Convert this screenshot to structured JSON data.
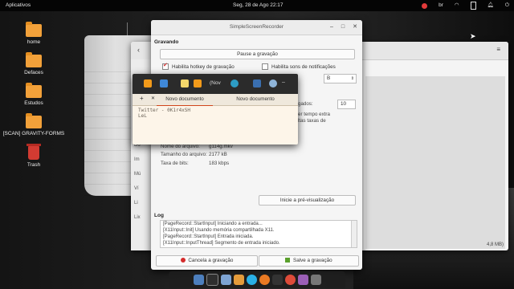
{
  "topbar": {
    "apps_label": "Aplicativos",
    "clock": "Seg, 28 de Ago   22:17",
    "keyboard_layout": "br"
  },
  "desktop": {
    "icons": [
      {
        "label": "home",
        "kind": "folder"
      },
      {
        "label": "Defaces",
        "kind": "folder"
      },
      {
        "label": "Estudos",
        "kind": "folder"
      },
      {
        "label": "[SCAN] GRAVITY-FORMS",
        "kind": "folder"
      },
      {
        "label": "Trash",
        "kind": "trash"
      }
    ]
  },
  "background_window": {
    "sidebar_items": [
      "Do",
      "Im",
      "Mú",
      "Ví",
      "Li",
      "Lix"
    ],
    "size_cell": "4,8 MB)"
  },
  "recorder": {
    "title": "SimpleScreenRecorder",
    "section_recording": "Gravando",
    "pause_button": "Pause a gravação",
    "hotkey_checkbox": "Habilita hotkey de gravação",
    "hotkey_checked": true,
    "sound_checkbox": "Habilita sons de notificações",
    "sound_checked": false,
    "key_select": "B",
    "frames_label": "gados:",
    "frames_value": "10",
    "text_fragment_1": "er tempo extra",
    "text_fragment_2": "ltas taxas de",
    "fields": [
      {
        "label": "Nome do arquivo:",
        "value": "g114g.mkv"
      },
      {
        "label": "Tamanho do arquivo:",
        "value": "2177 kB"
      },
      {
        "label": "Taxa de bits:",
        "value": "183 kbps"
      }
    ],
    "preview_button": "Inicie a pré-visualização",
    "section_log": "Log",
    "log_lines": [
      "[PageRecord::StartInput] Iniciando a entrada...",
      "[X11Input::Init] Usando memória compartilhada X11.",
      "[PageRecord::StartInput] Entrada iniciada.",
      "[X11Input::InputThread] Segmento de entrada iniciado."
    ],
    "cancel_button": "Cancela a gravação",
    "save_button": "Salve a gravação",
    "colors": {
      "cancel_dot": "#d42c2c",
      "save_dot": "#5aa02c"
    }
  },
  "editor": {
    "toolbar_title": "(Nov",
    "tabs": [
      "Novo documento",
      "Novo documento"
    ],
    "lines": [
      "Twitter - 0K1r4xSH",
      "LeL"
    ],
    "colors": {
      "accent": "#d0451b",
      "bg": "#fdf5e9"
    }
  },
  "dock": {
    "apps": [
      "files-icon",
      "terminal-icon",
      "mail-icon",
      "photos-icon",
      "skype-icon",
      "firefox-icon",
      "terminal-icon",
      "chrome-icon",
      "music-icon",
      "camera-icon"
    ]
  }
}
